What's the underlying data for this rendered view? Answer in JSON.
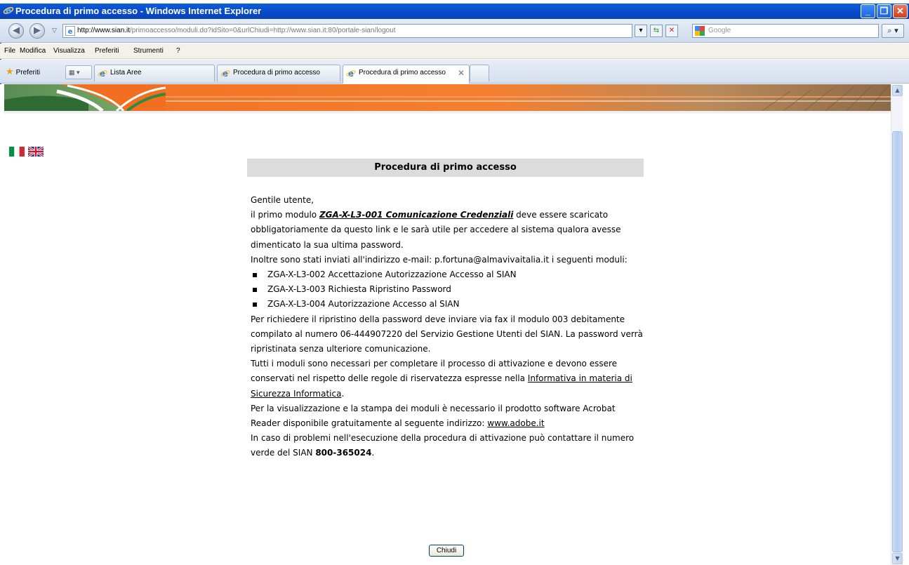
{
  "window": {
    "title": "Procedura di primo accesso - Windows Internet Explorer",
    "minimize": "_",
    "maximize": "❐",
    "close": "✕"
  },
  "address_bar": {
    "url_host": "http://www.sian.it",
    "url_path": "/primoaccesso/moduli.do?idSito=0&urlChiudi=http://www.sian.it:80/portale-sian/logout",
    "search_placeholder": "Google",
    "search_button": "⌕ ▾"
  },
  "menu": {
    "items": [
      "File",
      "Modifica",
      "Visualizza",
      "Preferiti",
      "Strumenti",
      "?"
    ]
  },
  "tabs": {
    "favorites_label": "Preferiti",
    "quick_tabs": "▦ ▾",
    "items": [
      {
        "label": "Lista Aree"
      },
      {
        "label": "Procedura di primo accesso"
      },
      {
        "label": "Procedura di primo accesso",
        "close": "✕"
      }
    ]
  },
  "page": {
    "heading": "Procedura di primo accesso",
    "greeting": "Gentile utente,",
    "p1_before": "il primo modulo ",
    "p1_link": "ZGA-X-L3-001 Comunicazione Credenziali",
    "p1_after": " deve essere scaricato obbligatoriamente da questo link e le sarà utile per accedere al sistema qualora avesse dimenticato la sua ultima password.",
    "p2": "Inoltre sono stati inviati all'indirizzo e-mail: p.fortuna@almavivaitalia.it i seguenti moduli:",
    "modules": [
      "ZGA-X-L3-002 Accettazione Autorizzazione Accesso al SIAN",
      "ZGA-X-L3-003 Richiesta Ripristino Password",
      "ZGA-X-L3-004 Autorizzazione Accesso al SIAN"
    ],
    "p3": "Per richiedere il ripristino della password deve inviare via fax il modulo 003 debitamente compilato al numero 06-444907220 del Servizio Gestione Utenti del SIAN. La password verrà ripristinata senza ulteriore comunicazione.",
    "p4_before": "Tutti i moduli sono necessari per completare il processo di attivazione e devono essere conservati nel rispetto delle regole di riservatezza espresse nella ",
    "p4_link": "Informativa in materia di Sicurezza Informatica",
    "p4_after": ".",
    "p5_before": "Per la visualizzazione e la stampa dei moduli è necessario il prodotto software Acrobat Reader disponibile gratuitamente al seguente indirizzo:  ",
    "p5_link": "www.adobe.it",
    "p6_before": "In caso di problemi nell'esecuzione della procedura di attivazione può contattare il numero verde del SIAN ",
    "p6_phone": "800-365024",
    "p6_after": ".",
    "close_button": "Chiudi"
  },
  "colors": {
    "titlebar": "#0a4ed0",
    "banner_orange": "#f26f21",
    "banner_green": "#2f8a3c",
    "header_bg": "#dcdcdc"
  }
}
